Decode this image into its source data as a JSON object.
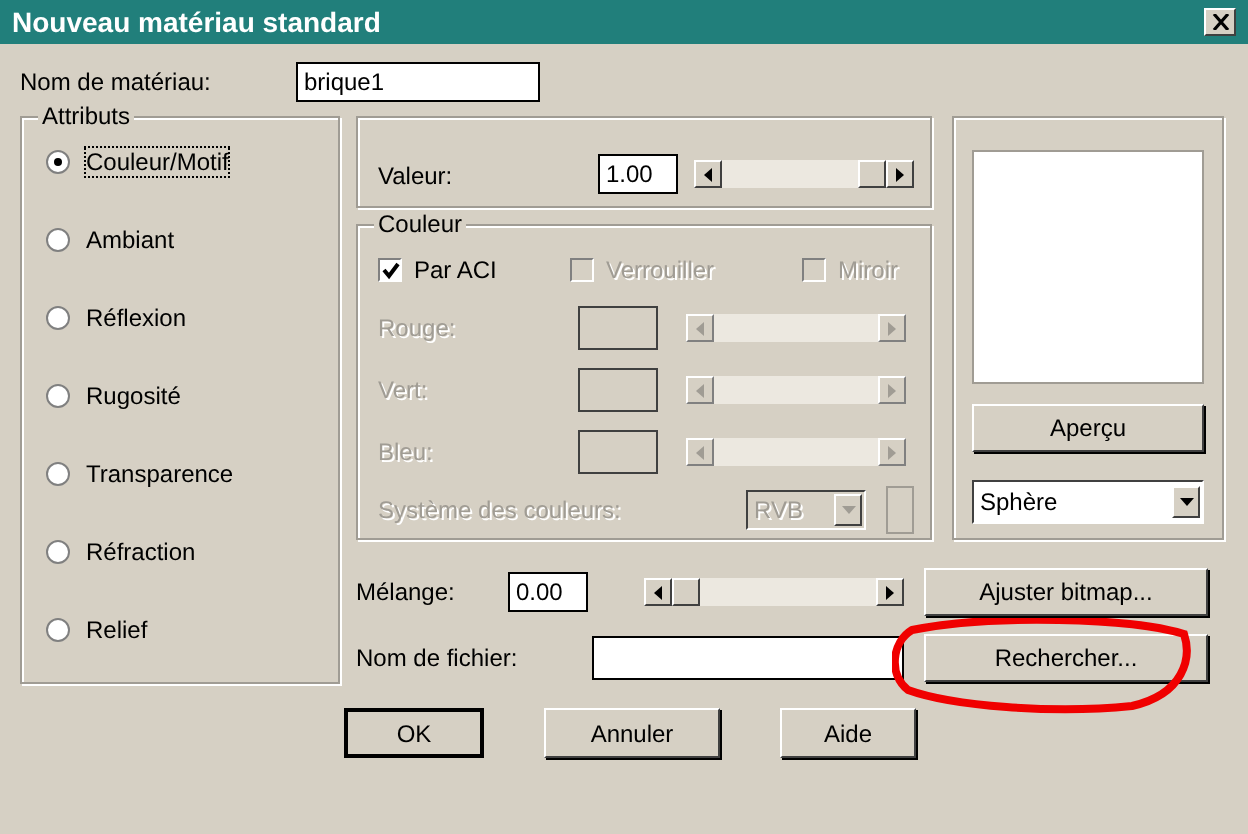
{
  "window": {
    "title": "Nouveau matériau standard"
  },
  "material_name": {
    "label": "Nom de matériau:",
    "value": "brique1"
  },
  "attributes": {
    "title": "Attributs",
    "options": [
      {
        "label": "Couleur/Motif",
        "selected": true
      },
      {
        "label": "Ambiant",
        "selected": false
      },
      {
        "label": "Réflexion",
        "selected": false
      },
      {
        "label": "Rugosité",
        "selected": false
      },
      {
        "label": "Transparence",
        "selected": false
      },
      {
        "label": "Réfraction",
        "selected": false
      },
      {
        "label": "Relief",
        "selected": false
      }
    ]
  },
  "value": {
    "label": "Valeur:",
    "value": "1.00",
    "level": 1.0
  },
  "color": {
    "title": "Couleur",
    "checkboxes": [
      {
        "label": "Par ACI",
        "checked": true,
        "disabled": false
      },
      {
        "label": "Verrouiller",
        "checked": false,
        "disabled": true
      },
      {
        "label": "Miroir",
        "checked": false,
        "disabled": true
      }
    ],
    "channels": [
      {
        "label": "Rouge:",
        "disabled": true
      },
      {
        "label": "Vert:",
        "disabled": true
      },
      {
        "label": "Bleu:",
        "disabled": true
      }
    ],
    "system": {
      "label": "Système des couleurs:",
      "value": "RVB",
      "disabled": true
    }
  },
  "preview": {
    "button": "Aperçu",
    "shape": "Sphère"
  },
  "blend": {
    "label": "Mélange:",
    "value": "0.00",
    "level": 0.0
  },
  "bitmap_button": "Ajuster bitmap...",
  "file": {
    "label": "Nom de fichier:"
  },
  "browse_button": {
    "label": "Rechercher...",
    "highlighted": true
  },
  "buttons": [
    {
      "label": "OK",
      "default": true
    },
    {
      "label": "Annuler",
      "default": false
    },
    {
      "label": "Aide",
      "default": false
    }
  ]
}
